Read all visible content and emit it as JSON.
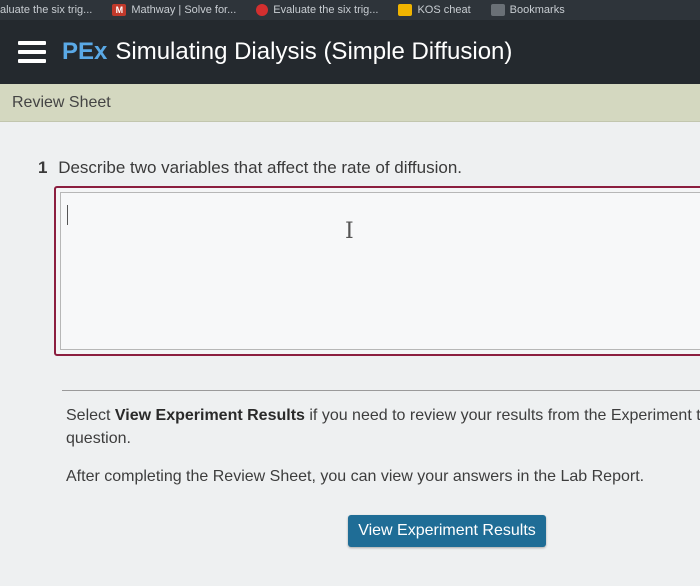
{
  "bookmarks": [
    {
      "label": "aluate the six trig...",
      "icon": "none"
    },
    {
      "label": "Mathway | Solve for...",
      "icon": "mathway-icon"
    },
    {
      "label": "Evaluate the six trig...",
      "icon": "red-circle-icon"
    },
    {
      "label": "KOS cheat",
      "icon": "folder-icon"
    },
    {
      "label": "Bookmarks",
      "icon": "bookmark-icon"
    }
  ],
  "header": {
    "title_prefix": "PEx",
    "title": "Simulating Dialysis (Simple Diffusion)"
  },
  "review_bar": {
    "label": "Review Sheet"
  },
  "question": {
    "number": "1",
    "text": "Describe two variables that affect the rate of diffusion.",
    "answer_value": ""
  },
  "instructions": {
    "select_prefix": "Select ",
    "select_bold": "View Experiment Results",
    "select_suffix": " if you need to review your results from the Experiment to",
    "select_line2": "question.",
    "after_text": "After completing the Review Sheet, you can view your answers in the Lab Report."
  },
  "button": {
    "label": "View Experiment Results"
  },
  "colors": {
    "header_bg": "#24292e",
    "prefix": "#5aa9e6",
    "review_bar_bg": "#d4d8c0",
    "answer_border": "#8b1e3f",
    "button_bg": "#1f6d96"
  }
}
